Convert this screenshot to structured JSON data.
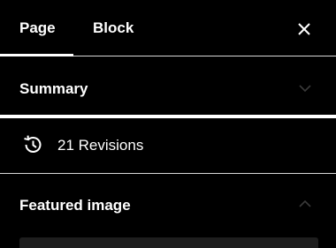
{
  "tabs": {
    "page_label": "Page",
    "block_label": "Block",
    "active": "Page"
  },
  "summary": {
    "title": "Summary",
    "expanded": false
  },
  "revisions": {
    "label": "21 Revisions",
    "icon": "history-icon"
  },
  "featured_image": {
    "title": "Featured image",
    "expanded": true
  },
  "colors": {
    "background": "#000000",
    "text": "#ffffff",
    "divider": "#d9d9d9",
    "chevron": "#3a3a3a",
    "placeholder": "#1e1e1e"
  }
}
